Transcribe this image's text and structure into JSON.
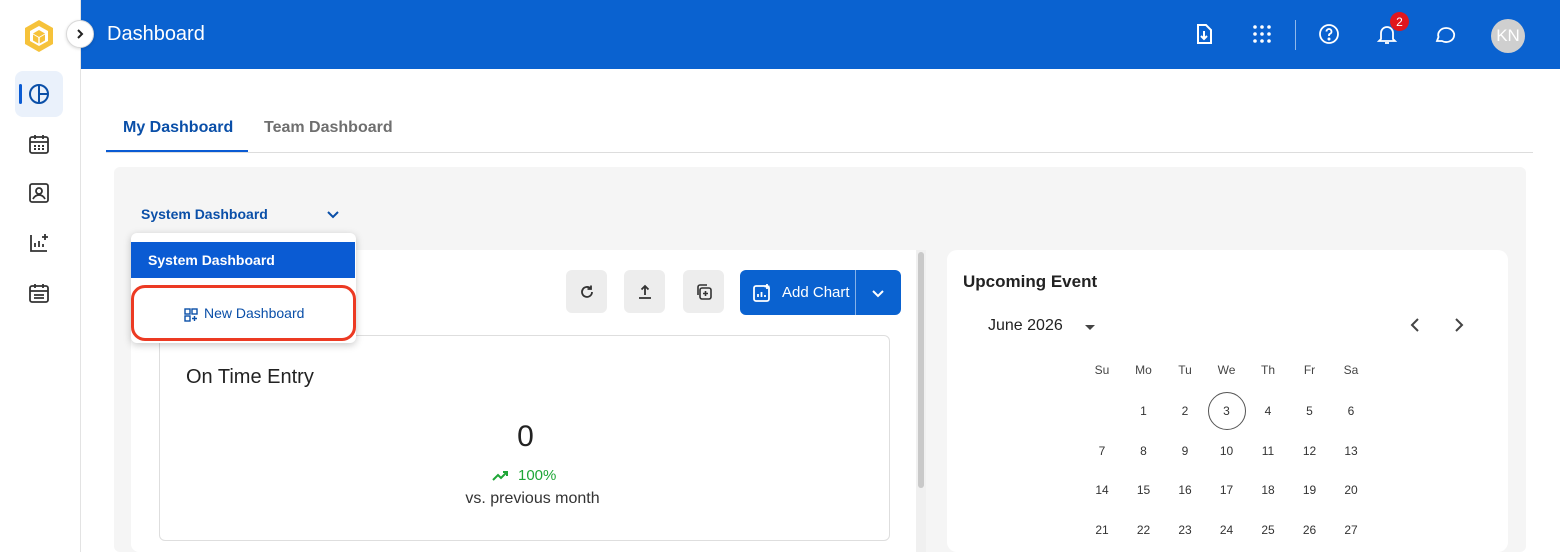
{
  "app": {
    "page_title": "Dashboard",
    "avatar_initials": "KN",
    "notification_count": "2"
  },
  "rail": {
    "items": [
      {
        "icon": "pie-chart-icon",
        "active": true
      },
      {
        "icon": "calendar-grid-icon"
      },
      {
        "icon": "contact-card-icon"
      },
      {
        "icon": "chart-add-icon"
      },
      {
        "icon": "calendar-list-icon"
      }
    ]
  },
  "topbar_icons": [
    "download-icon",
    "apps-grid-icon",
    "help-icon",
    "bell-icon",
    "chat-icon"
  ],
  "tabs": [
    {
      "label": "My Dashboard"
    },
    {
      "label": "Team Dashboard"
    }
  ],
  "dashboard_select": {
    "value": "System Dashboard"
  },
  "dropdown": {
    "selected": "System Dashboard",
    "new_label": "New Dashboard"
  },
  "toolbar": {
    "add_chart_label": "Add Chart"
  },
  "kpi": {
    "title": "On Time Entry",
    "value": "0",
    "trend": "100%",
    "caption": "vs. previous month"
  },
  "event": {
    "title": "Upcoming Event",
    "month": "June 2026",
    "weekdays": [
      "Su",
      "Mo",
      "Tu",
      "We",
      "Th",
      "Fr",
      "Sa"
    ],
    "days": [
      [
        "",
        "1",
        "2",
        "3",
        "4",
        "5",
        "6"
      ],
      [
        "7",
        "8",
        "9",
        "10",
        "11",
        "12",
        "13"
      ],
      [
        "14",
        "15",
        "16",
        "17",
        "18",
        "19",
        "20"
      ],
      [
        "21",
        "22",
        "23",
        "24",
        "25",
        "26",
        "27"
      ]
    ],
    "today": "3"
  },
  "colors": {
    "brand_blue": "#0a62d0",
    "trend_green": "#1fa637",
    "badge_red": "#e1161c",
    "highlight_red": "#ec3a23"
  }
}
